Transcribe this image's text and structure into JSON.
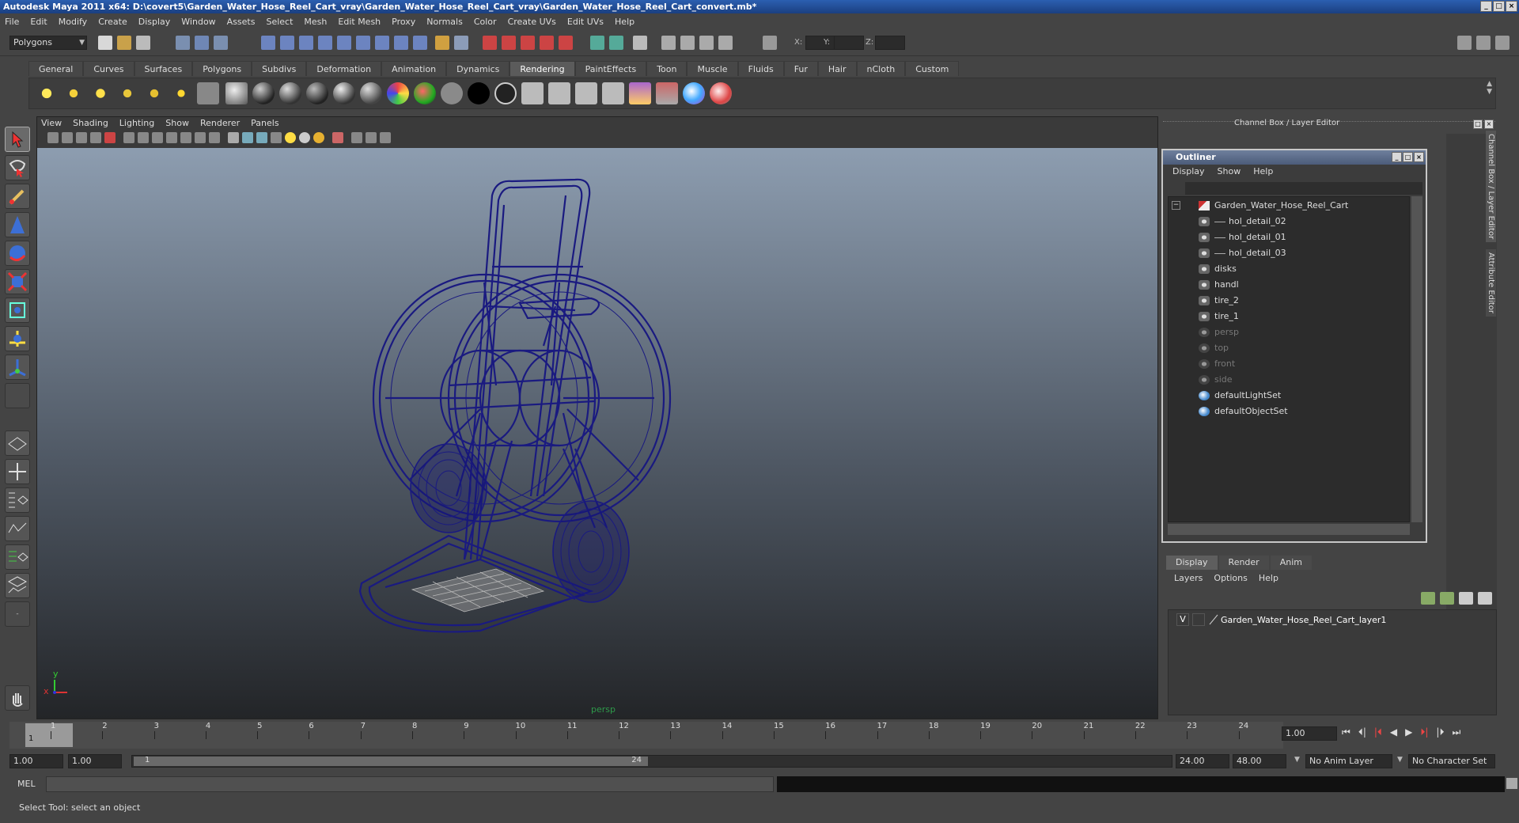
{
  "window": {
    "title": "Autodesk Maya 2011 x64: D:\\covert5\\Garden_Water_Hose_Reel_Cart_vray\\Garden_Water_Hose_Reel_Cart_vray\\Garden_Water_Hose_Reel_Cart_convert.mb*"
  },
  "menubar": [
    "File",
    "Edit",
    "Modify",
    "Create",
    "Display",
    "Window",
    "Assets",
    "Select",
    "Mesh",
    "Edit Mesh",
    "Proxy",
    "Normals",
    "Color",
    "Create UVs",
    "Edit UVs",
    "Help"
  ],
  "statusline": {
    "mode": "Polygons",
    "x_label": "X:",
    "y_label": "Y:",
    "z_label": "Z:"
  },
  "shelf": {
    "tabs": [
      "General",
      "Curves",
      "Surfaces",
      "Polygons",
      "Subdivs",
      "Deformation",
      "Animation",
      "Dynamics",
      "Rendering",
      "PaintEffects",
      "Toon",
      "Muscle",
      "Fluids",
      "Fur",
      "Hair",
      "nCloth",
      "Custom"
    ],
    "active_tab": "Rendering"
  },
  "viewport": {
    "menu": [
      "View",
      "Shading",
      "Lighting",
      "Show",
      "Renderer",
      "Panels"
    ],
    "camera": "persp",
    "axis_x": "x",
    "axis_y": "y",
    "wire_color": "#1a1a80"
  },
  "channel_box": {
    "title": "Channel Box / Layer Editor",
    "side_tab_1": "Channel Box / Layer Editor",
    "side_tab_2": "Attribute Editor"
  },
  "outliner": {
    "title": "Outliner",
    "menu": [
      "Display",
      "Show",
      "Help"
    ],
    "items": [
      {
        "label": "Garden_Water_Hose_Reel_Cart",
        "indent": 0,
        "icon": "group-icon",
        "dim": false
      },
      {
        "label": "hol_detail_02",
        "indent": 1,
        "icon": "mesh-icon",
        "dim": false
      },
      {
        "label": "hol_detail_01",
        "indent": 1,
        "icon": "mesh-icon",
        "dim": false
      },
      {
        "label": "hol_detail_03",
        "indent": 1,
        "icon": "mesh-icon",
        "dim": false
      },
      {
        "label": "disks",
        "indent": 0,
        "icon": "mesh-icon",
        "dim": false
      },
      {
        "label": "handl",
        "indent": 0,
        "icon": "mesh-icon",
        "dim": false
      },
      {
        "label": "tire_2",
        "indent": 0,
        "icon": "mesh-icon",
        "dim": false
      },
      {
        "label": "tire_1",
        "indent": 0,
        "icon": "mesh-icon",
        "dim": false
      },
      {
        "label": "persp",
        "indent": 0,
        "icon": "camera-icon",
        "dim": true
      },
      {
        "label": "top",
        "indent": 0,
        "icon": "camera-icon",
        "dim": true
      },
      {
        "label": "front",
        "indent": 0,
        "icon": "camera-icon",
        "dim": true
      },
      {
        "label": "side",
        "indent": 0,
        "icon": "camera-icon",
        "dim": true
      },
      {
        "label": "defaultLightSet",
        "indent": 0,
        "icon": "set-icon",
        "dim": false
      },
      {
        "label": "defaultObjectSet",
        "indent": 0,
        "icon": "set-icon",
        "dim": false
      }
    ]
  },
  "layer_editor": {
    "tabs": [
      "Display",
      "Render",
      "Anim"
    ],
    "active_tab": "Display",
    "menu": [
      "Layers",
      "Options",
      "Help"
    ],
    "layer_visible": "V",
    "layer_name": "Garden_Water_Hose_Reel_Cart_layer1"
  },
  "timeline": {
    "ticks": [
      "1",
      "2",
      "3",
      "4",
      "5",
      "6",
      "7",
      "8",
      "9",
      "10",
      "11",
      "12",
      "13",
      "14",
      "15",
      "16",
      "17",
      "18",
      "19",
      "20",
      "21",
      "22",
      "23",
      "24"
    ],
    "current_marker": "1",
    "current_frame": "1.00"
  },
  "range": {
    "start": "1.00",
    "playback_start": "1.00",
    "slider_start": "1",
    "slider_end": "24",
    "playback_end": "24.00",
    "end": "48.00",
    "anim_layer": "No Anim Layer",
    "character_set": "No Character Set"
  },
  "command": {
    "label": "MEL"
  },
  "help_line": "Select Tool: select an object"
}
